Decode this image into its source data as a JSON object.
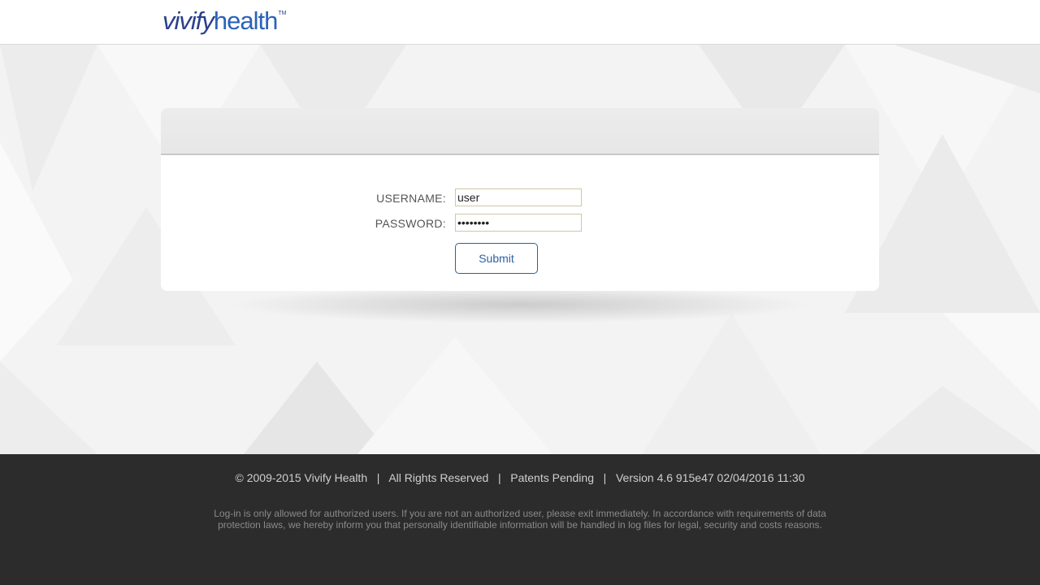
{
  "header": {
    "logo": {
      "part1": "vivify",
      "part2": "health",
      "tm": "TM"
    }
  },
  "login": {
    "username_label": "USERNAME:",
    "password_label": "PASSWORD:",
    "username_value": "user",
    "password_value": "password",
    "submit_label": "Submit"
  },
  "footer": {
    "copyright": "© 2009-2015 Vivify Health",
    "rights": "All Rights Reserved",
    "patents": "Patents Pending",
    "version": "Version 4.6 915e47 02/04/2016 11:30",
    "separator": "|",
    "disclaimer": "Log-in is only allowed for authorized users. If you are not an authorized user, please exit immediately. In accordance with requirements of data protection laws, we hereby inform you that personally identifiable information will be handled in log files for legal, security and costs reasons."
  },
  "colors": {
    "brand_dark": "#2b3f8c",
    "brand_light": "#2a63b8",
    "button_border": "#2c5fa3",
    "footer_bg": "#2c2c2c"
  }
}
